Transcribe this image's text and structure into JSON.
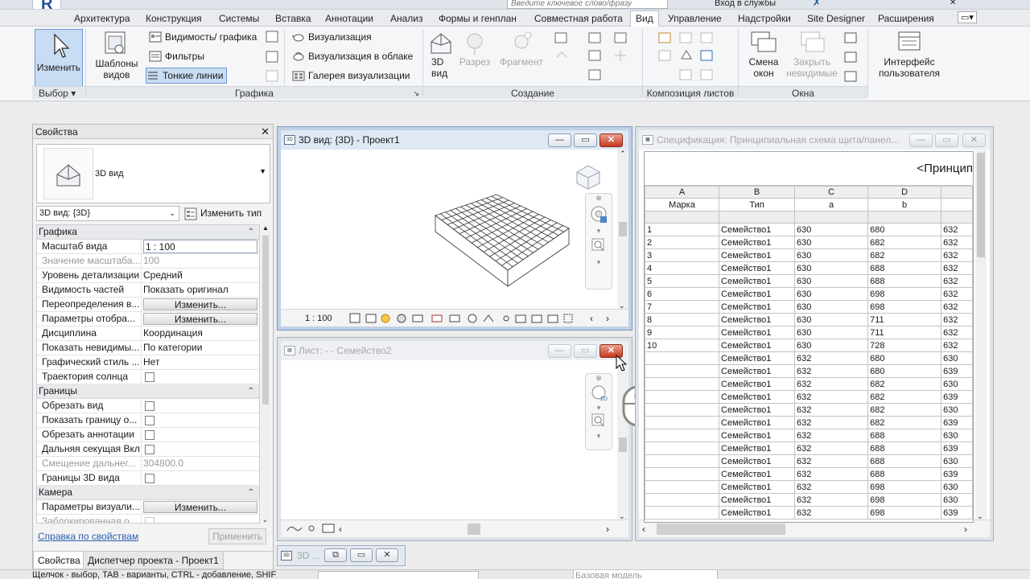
{
  "app": {
    "search_placeholder": "Введите ключевое слово/фразу",
    "sign_in_label": "Вход в службы"
  },
  "ribbon_tabs": [
    {
      "label": "Архитектура"
    },
    {
      "label": "Конструкция"
    },
    {
      "label": "Системы"
    },
    {
      "label": "Вставка"
    },
    {
      "label": "Аннотации"
    },
    {
      "label": "Анализ"
    },
    {
      "label": "Формы и генплан"
    },
    {
      "label": "Совместная работа"
    },
    {
      "label": "Вид",
      "active": true
    },
    {
      "label": "Управление"
    },
    {
      "label": "Надстройки"
    },
    {
      "label": "Site Designer"
    },
    {
      "label": "Расширения"
    }
  ],
  "ribbon": {
    "select_group": {
      "modify_label": "Изменить",
      "panel_label": "Выбор"
    },
    "graphics_group": {
      "templates_label": "Шаблоны\nвидов",
      "visibility_label": "Видимость/ графика",
      "filters_label": "Фильтры",
      "thin_lines_label": "Тонкие линии",
      "render_label": "Визуализация",
      "render_cloud_label": "Визуализация  в облаке",
      "render_gallery_label": "Галерея  визуализации",
      "panel_label": "Графика"
    },
    "create_group": {
      "view3d_label": "3D\nвид",
      "section_label": "Разрез",
      "callout_label": "Фрагмент",
      "panel_label": "Создание"
    },
    "sheet_group": {
      "panel_label": "Композиция листов"
    },
    "window_group": {
      "switch_label": "Смена\nокон",
      "close_hidden_label": "Закрыть\nневидимые",
      "panel_label": "Окна"
    },
    "ui_group": {
      "ui_label": "Интерфейс\nпользователя"
    }
  },
  "properties": {
    "title": "Свойства",
    "type_name": "3D вид",
    "view_selector": "3D вид: {3D}",
    "edit_type_label": "Изменить тип",
    "sections": [
      {
        "name": "Графика",
        "rows": [
          {
            "name": "Масштаб вида",
            "value": "1 : 100",
            "kind": "input"
          },
          {
            "name": "Значение масштаба...",
            "value": "100",
            "kind": "dim"
          },
          {
            "name": "Уровень детализации",
            "value": "Средний",
            "kind": "text"
          },
          {
            "name": "Видимость частей",
            "value": "Показать оригинал",
            "kind": "text"
          },
          {
            "name": "Переопределения в...",
            "value": "Изменить...",
            "kind": "button"
          },
          {
            "name": "Параметры отобра...",
            "value": "Изменить...",
            "kind": "button"
          },
          {
            "name": "Дисциплина",
            "value": "Координация",
            "kind": "text"
          },
          {
            "name": "Показать невидимы...",
            "value": "По категории",
            "kind": "text"
          },
          {
            "name": "Графический стиль ...",
            "value": "Нет",
            "kind": "text"
          },
          {
            "name": "Траектория солнца",
            "value": "",
            "kind": "checkbox"
          }
        ]
      },
      {
        "name": "Границы",
        "rows": [
          {
            "name": "Обрезать вид",
            "value": "",
            "kind": "checkbox"
          },
          {
            "name": "Показать границу о...",
            "value": "",
            "kind": "checkbox"
          },
          {
            "name": "Обрезать аннотации",
            "value": "",
            "kind": "checkbox"
          },
          {
            "name": "Дальняя секущая Вкл",
            "value": "",
            "kind": "checkbox"
          },
          {
            "name": "Смещение дальнег...",
            "value": "304800.0",
            "kind": "dim"
          },
          {
            "name": "Границы 3D вида",
            "value": "",
            "kind": "checkbox"
          }
        ]
      },
      {
        "name": "Камера",
        "rows": [
          {
            "name": "Параметры визуали...",
            "value": "Изменить...",
            "kind": "button"
          },
          {
            "name": "Заблокированная о...",
            "value": "",
            "kind": "dimcheckbox"
          }
        ]
      }
    ],
    "help_link": "Справка по свойствам",
    "apply_label": "Применить",
    "bottom_tabs": [
      "Свойства",
      "Диспетчер проекта - Проект1"
    ]
  },
  "view3d": {
    "title": "3D вид: {3D} - Проект1",
    "scale": "1 : 100"
  },
  "sheet_view": {
    "title": "Лист: -  - Семейство2"
  },
  "schedule": {
    "title": "Спецификация: Принципиальная схема щита/панел...",
    "heading": "<Принцип",
    "column_letters": [
      "A",
      "B",
      "C",
      "D",
      ""
    ],
    "headers": [
      "Марка",
      "Тип",
      "a",
      "b",
      ""
    ],
    "rows": [
      [
        "1",
        "Семейство1",
        "630",
        "680",
        "632"
      ],
      [
        "2",
        "Семейство1",
        "630",
        "682",
        "632"
      ],
      [
        "3",
        "Семейство1",
        "630",
        "682",
        "632"
      ],
      [
        "4",
        "Семейство1",
        "630",
        "688",
        "632"
      ],
      [
        "5",
        "Семейство1",
        "630",
        "688",
        "632"
      ],
      [
        "6",
        "Семейство1",
        "630",
        "698",
        "632"
      ],
      [
        "7",
        "Семейство1",
        "630",
        "698",
        "632"
      ],
      [
        "8",
        "Семейство1",
        "630",
        "711",
        "632"
      ],
      [
        "9",
        "Семейство1",
        "630",
        "711",
        "632"
      ],
      [
        "10",
        "Семейство1",
        "630",
        "728",
        "632"
      ],
      [
        "",
        "Семейство1",
        "632",
        "680",
        "630"
      ],
      [
        "",
        "Семейство1",
        "632",
        "680",
        "639"
      ],
      [
        "",
        "Семейство1",
        "632",
        "682",
        "630"
      ],
      [
        "",
        "Семейство1",
        "632",
        "682",
        "639"
      ],
      [
        "",
        "Семейство1",
        "632",
        "682",
        "630"
      ],
      [
        "",
        "Семейство1",
        "632",
        "682",
        "639"
      ],
      [
        "",
        "Семейство1",
        "632",
        "688",
        "630"
      ],
      [
        "",
        "Семейство1",
        "632",
        "688",
        "639"
      ],
      [
        "",
        "Семейство1",
        "632",
        "688",
        "630"
      ],
      [
        "",
        "Семейство1",
        "632",
        "688",
        "639"
      ],
      [
        "",
        "Семейство1",
        "632",
        "698",
        "630"
      ],
      [
        "",
        "Семейство1",
        "632",
        "698",
        "630"
      ],
      [
        "",
        "Семейство1",
        "632",
        "698",
        "639"
      ]
    ]
  },
  "minimized_window": {
    "label": "3D ..."
  },
  "statusbar": {
    "text": "Щелчок - выбор, TAB - варианты, CTRL - добавление, SHIF",
    "model_label": "Базовая модель"
  }
}
